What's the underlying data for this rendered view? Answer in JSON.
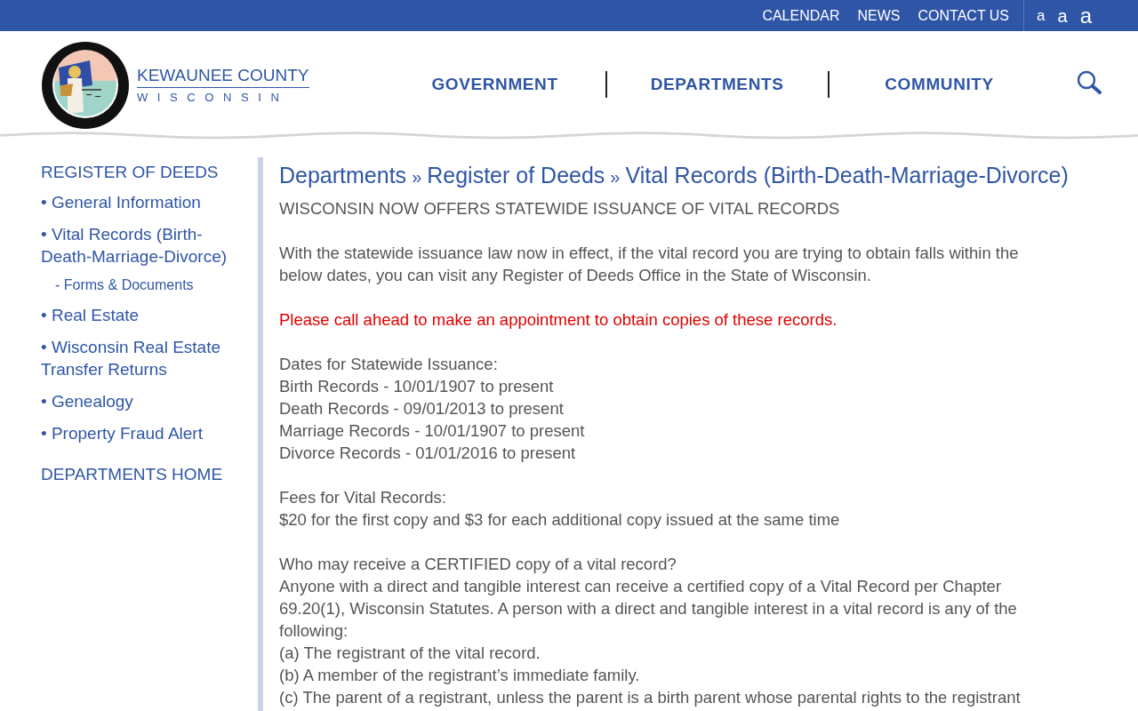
{
  "top_links": [
    "CALENDAR",
    "NEWS",
    "CONTACT US"
  ],
  "font_sizes": [
    "a",
    "a",
    "a"
  ],
  "logo": {
    "name": "KEWAUNEE COUNTY",
    "sub": "WISCONSIN"
  },
  "nav": [
    "GOVERNMENT",
    "DEPARTMENTS",
    "COMMUNITY"
  ],
  "sidebar": {
    "title": "REGISTER OF DEEDS",
    "bullet": "•",
    "dash": "-",
    "items": [
      {
        "label": "General Information"
      },
      {
        "label": "Vital Records (Birth-Death-Marriage-Divorce)",
        "children": [
          "Forms & Documents"
        ]
      },
      {
        "label": "Real Estate"
      },
      {
        "label": "Wisconsin Real Estate Transfer Returns"
      },
      {
        "label": "Genealogy"
      },
      {
        "label": "Property Fraud Alert"
      }
    ],
    "home": "DEPARTMENTS HOME"
  },
  "breadcrumb": {
    "separator": "»",
    "items": [
      "Departments",
      "Register of Deeds",
      "Vital Records (Birth-Death-Marriage-Divorce)"
    ]
  },
  "content": [
    {
      "kind": "text",
      "lines": [
        "WISCONSIN NOW OFFERS STATEWIDE ISSUANCE OF VITAL RECORDS"
      ]
    },
    {
      "kind": "text",
      "lines": [
        "With the statewide issuance law now in effect, if the vital record you are trying to obtain falls within the below dates, you can visit any Register of Deeds Office in the State of Wisconsin."
      ]
    },
    {
      "kind": "alert",
      "lines": [
        "Please call ahead to make an appointment to obtain copies of these records."
      ]
    },
    {
      "kind": "text",
      "lines": [
        "Dates for Statewide Issuance:",
        "Birth Records - 10/01/1907 to present",
        "Death Records - 09/01/2013 to present",
        "Marriage Records - 10/01/1907 to present",
        "Divorce Records - 01/01/2016 to present"
      ]
    },
    {
      "kind": "text",
      "lines": [
        "Fees for Vital Records:",
        "$20 for the first copy and $3 for each additional copy issued at the same time"
      ]
    },
    {
      "kind": "text",
      "lines": [
        "Who may receive a CERTIFIED copy of a vital record?",
        "Anyone with a direct and tangible interest can receive a certified copy of a Vital Record per Chapter 69.20(1), Wisconsin Statutes. A person with a direct and tangible interest in a vital record is any of the following:",
        "(a) The registrant of the vital record.",
        "(b) A member of the registrant’s immediate family.",
        "(c) The parent of a registrant, unless the parent is a birth parent whose parental rights to the registrant"
      ]
    }
  ]
}
